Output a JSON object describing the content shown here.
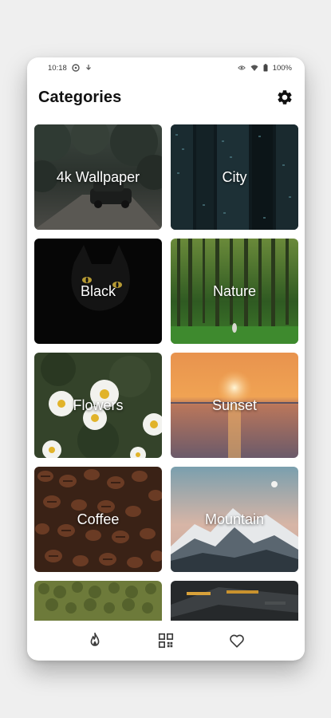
{
  "status_bar": {
    "time": "10:18",
    "battery": "100%"
  },
  "header": {
    "title": "Categories",
    "settings_icon": "gear-icon"
  },
  "categories": [
    {
      "label": "4k Wallpaper"
    },
    {
      "label": "City"
    },
    {
      "label": "Black"
    },
    {
      "label": "Nature"
    },
    {
      "label": "Flowers"
    },
    {
      "label": "Sunset"
    },
    {
      "label": "Coffee"
    },
    {
      "label": "Mountain"
    },
    {
      "label": ""
    },
    {
      "label": ""
    }
  ],
  "bottom_nav": {
    "items": [
      {
        "icon": "flame-icon"
      },
      {
        "icon": "grid-icon"
      },
      {
        "icon": "heart-icon"
      }
    ]
  },
  "colors": {
    "background": "#efefef",
    "surface": "#ffffff",
    "title": "#111111",
    "label": "#ffffff"
  }
}
